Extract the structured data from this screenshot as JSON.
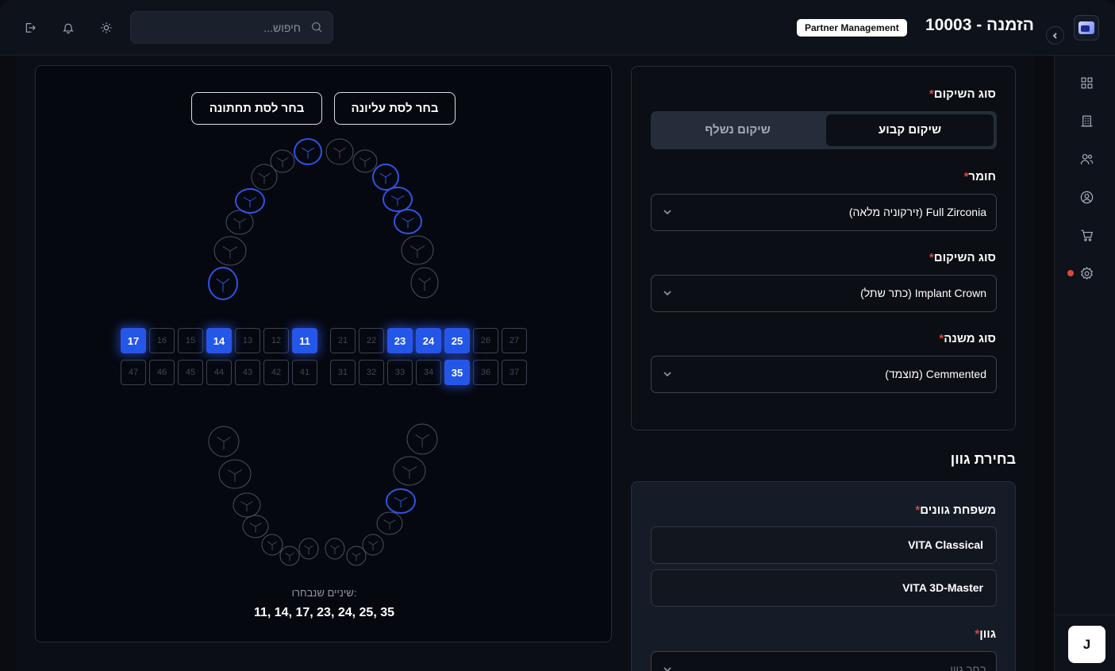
{
  "header": {
    "title": "הזמנה - 10003",
    "badge": "Partner Management",
    "search_placeholder": "חיפוש..."
  },
  "sidebar": {
    "items": [
      {
        "icon": "dashboard-icon"
      },
      {
        "icon": "building-icon"
      },
      {
        "icon": "users-icon"
      },
      {
        "icon": "user-circle-icon"
      },
      {
        "icon": "cart-icon"
      },
      {
        "icon": "gear-icon",
        "notification": true
      }
    ],
    "avatar": "J"
  },
  "restoration": {
    "type_label": "סוג השיקום",
    "required": "*",
    "fixed": "שיקום קבוע",
    "removable": "שיקום נשלף",
    "material_label": "חומר",
    "material_value": "Full Zirconia (זירקוניה מלאה)",
    "subtype_label": "סוג השיקום",
    "subtype_value": "Implant Crown (כתר שתל)",
    "secondary_label": "סוג משנה",
    "secondary_value": "Cemmented (מוצמד)"
  },
  "shade": {
    "section_title": "בחירת גוון",
    "family_label": "משפחת גוונים",
    "options": [
      "VITA Classical",
      "VITA 3D-Master"
    ],
    "color_label": "גוון",
    "color_placeholder": "בחר גוון"
  },
  "teeth": {
    "upper_button": "בחר לסת עליונה",
    "lower_button": "בחר לסת תחתונה",
    "upper_row": [
      "17",
      "16",
      "15",
      "14",
      "13",
      "12",
      "11",
      "21",
      "22",
      "23",
      "24",
      "25",
      "26",
      "27"
    ],
    "lower_row": [
      "47",
      "46",
      "45",
      "44",
      "43",
      "42",
      "41",
      "31",
      "32",
      "33",
      "34",
      "35",
      "36",
      "37"
    ],
    "selected": [
      "11",
      "14",
      "17",
      "23",
      "24",
      "25",
      "35"
    ],
    "selected_label": "שיניים שנבחרו:",
    "selected_text": "11, 14, 17, 23, 24, 25, 35"
  },
  "colors": {
    "accent": "#2357e8",
    "required": "#e0443c"
  }
}
